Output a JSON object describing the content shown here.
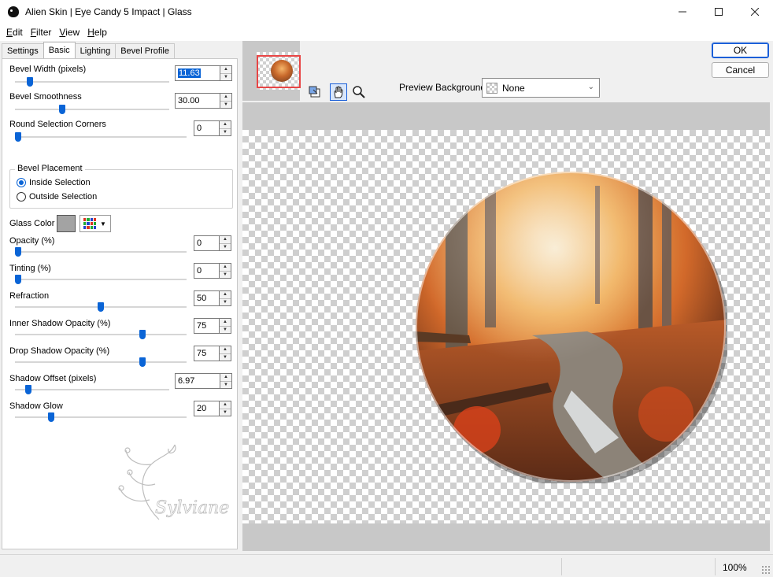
{
  "window": {
    "title": "Alien Skin | Eye Candy 5 Impact | Glass",
    "minimize_icon": "minimize-icon",
    "maximize_icon": "maximize-icon",
    "close_icon": "close-icon"
  },
  "menu": [
    {
      "accel": "E",
      "rest": "dit"
    },
    {
      "accel": "F",
      "rest": "ilter"
    },
    {
      "accel": "V",
      "rest": "iew"
    },
    {
      "accel": "H",
      "rest": "elp"
    }
  ],
  "tabs": [
    "Settings",
    "Basic",
    "Lighting",
    "Bevel Profile"
  ],
  "active_tab": "Basic",
  "controls": {
    "bevel_width": {
      "label": "Bevel Width (pixels)",
      "value": "11.63",
      "level": 0.08
    },
    "bevel_smoothness": {
      "label": "Bevel Smoothness",
      "value": "30.00",
      "level": 0.3
    },
    "round_corners": {
      "label": "Round Selection Corners",
      "value": "0",
      "level": 0
    },
    "opacity": {
      "label": "Opacity (%)",
      "value": "0",
      "level": 0
    },
    "tinting": {
      "label": "Tinting (%)",
      "value": "0",
      "level": 0
    },
    "refraction": {
      "label": "Refraction",
      "value": "50",
      "level": 0.5
    },
    "inner_shadow": {
      "label": "Inner Shadow Opacity (%)",
      "value": "75",
      "level": 0.75
    },
    "drop_shadow": {
      "label": "Drop Shadow Opacity (%)",
      "value": "75",
      "level": 0.75
    },
    "shadow_offset": {
      "label": "Shadow Offset (pixels)",
      "value": "6.97",
      "level": 0.07
    },
    "shadow_glow": {
      "label": "Shadow Glow",
      "value": "20",
      "level": 0.2
    }
  },
  "bevel_placement": {
    "title": "Bevel Placement",
    "options": [
      "Inside Selection",
      "Outside Selection"
    ],
    "selected": "Inside Selection"
  },
  "glass_color": {
    "label": "Glass Color",
    "color": "#a3a3a3"
  },
  "watermark": {
    "text": "Sylviane"
  },
  "preview": {
    "bg_label": "Preview Background:",
    "bg_value": "None"
  },
  "buttons": {
    "ok": "OK",
    "cancel": "Cancel"
  },
  "status": {
    "zoom": "100%"
  },
  "colors": {
    "accent": "#0a64d6",
    "thumb_border": "#e84545"
  }
}
